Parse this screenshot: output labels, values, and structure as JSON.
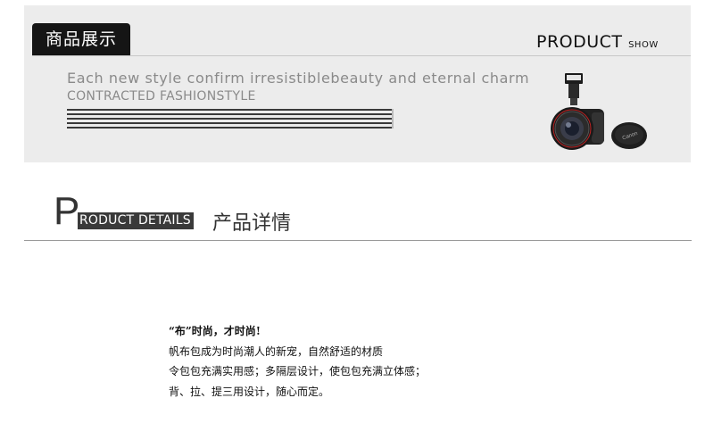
{
  "banner": {
    "tab_label": "商品展示",
    "product_word": "PRODUCT",
    "product_small": "SHOW",
    "tagline_1": "Each new style confirm irresistiblebeauty and eternal charm",
    "tagline_2": "CONTRACTED FASHIONSTYLE",
    "camera_icon": "camera-image",
    "background_color": "#ececec"
  },
  "details": {
    "big_letter": "P",
    "boxed_text": "RODUCT DETAILS",
    "cn_title": "产品详情"
  },
  "description": {
    "lines": [
      "“布”时尚，才时尚!",
      "帆布包成为时尚潮人的新宠，自然舒适的材质",
      "令包包充满实用感；多隔层设计，使包包充满立体感；",
      "背、拉、提三用设计，随心而定。"
    ]
  }
}
